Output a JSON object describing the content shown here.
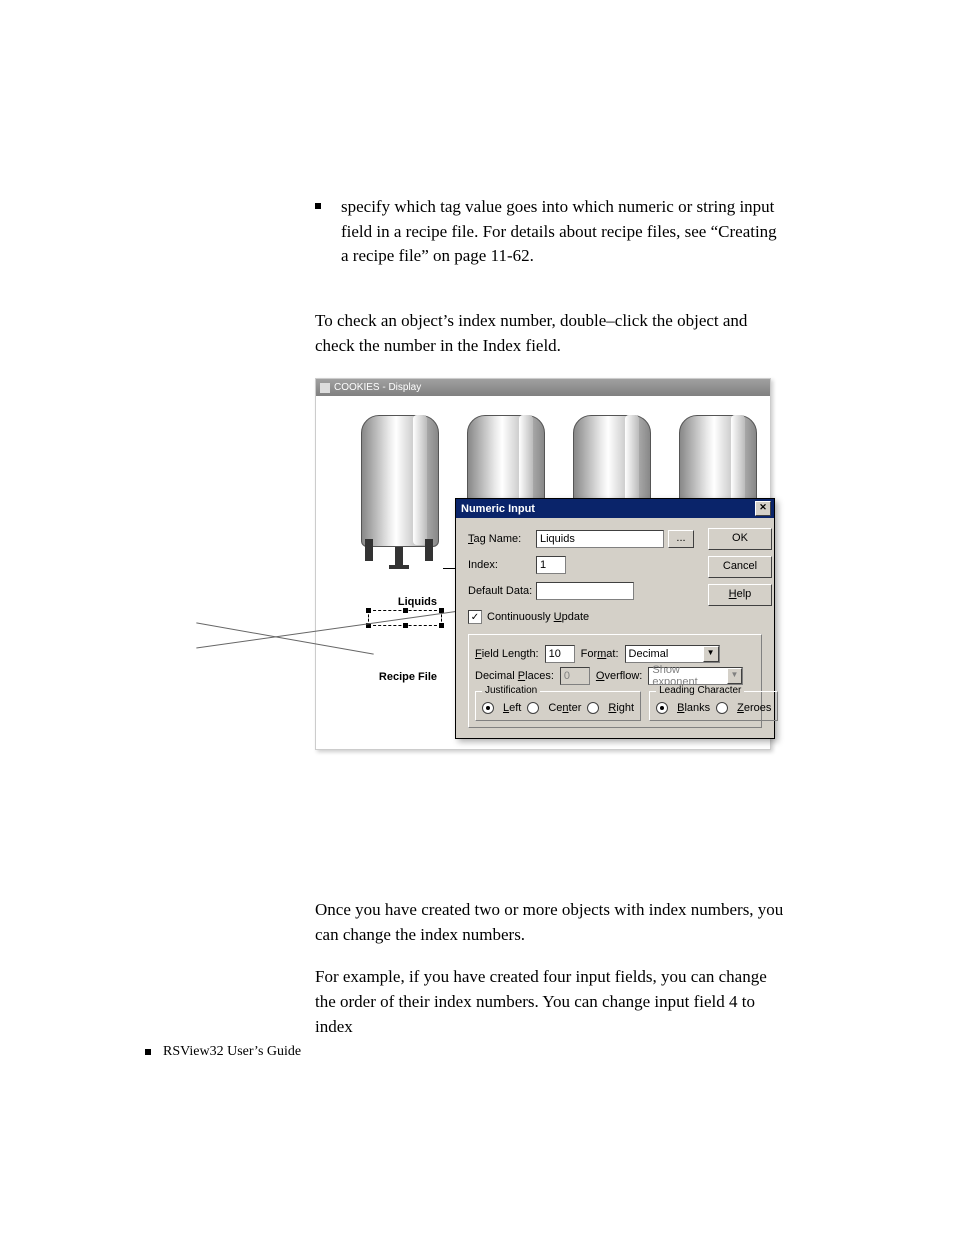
{
  "body": {
    "bullet1": "specify which tag value goes into which numeric or string input field in a recipe file. For details about recipe files, see “Creating a recipe file” on page 11-62.",
    "para_check": "To check an object’s index number, double–click the object and check the number in the Index field.",
    "para_after1": "Once you have created two or more objects with index numbers, you can change the index numbers.",
    "para_after2": "For example, if you have created four input fields, you can change the order of their index numbers. You can change input field 4 to index"
  },
  "figure": {
    "display_title": "COOKIES - Display",
    "label_liquids": "Liquids",
    "label_recipe": "Recipe File"
  },
  "dialog": {
    "title": "Numeric Input",
    "buttons": {
      "ok": "OK",
      "cancel": "Cancel",
      "help_u": "H",
      "help_rest": "elp"
    },
    "tag": {
      "label_u": "T",
      "label_rest": "ag Name:",
      "value": "Liquids",
      "browse": "..."
    },
    "index": {
      "label": "Index:",
      "value": "1"
    },
    "default_data": {
      "label": "Default Data:",
      "value": ""
    },
    "cont_update_checked": true,
    "cont_update_u": "U",
    "format": {
      "field_length_u": "F",
      "field_length_rest": "ield Length:",
      "field_length_value": "10",
      "format_value": "Decimal",
      "decimal_places_value": "0",
      "overflow_value": "Show exponent"
    },
    "justification": {
      "legend": "Justification",
      "selected": "Left",
      "options": [
        "Left",
        "Center",
        "Right"
      ]
    },
    "leading": {
      "legend": "Leading Character",
      "selected": "Blanks",
      "options": [
        "Blanks",
        "Zeroes"
      ]
    }
  },
  "footer": {
    "text": "RSView32  User’s Guide"
  }
}
